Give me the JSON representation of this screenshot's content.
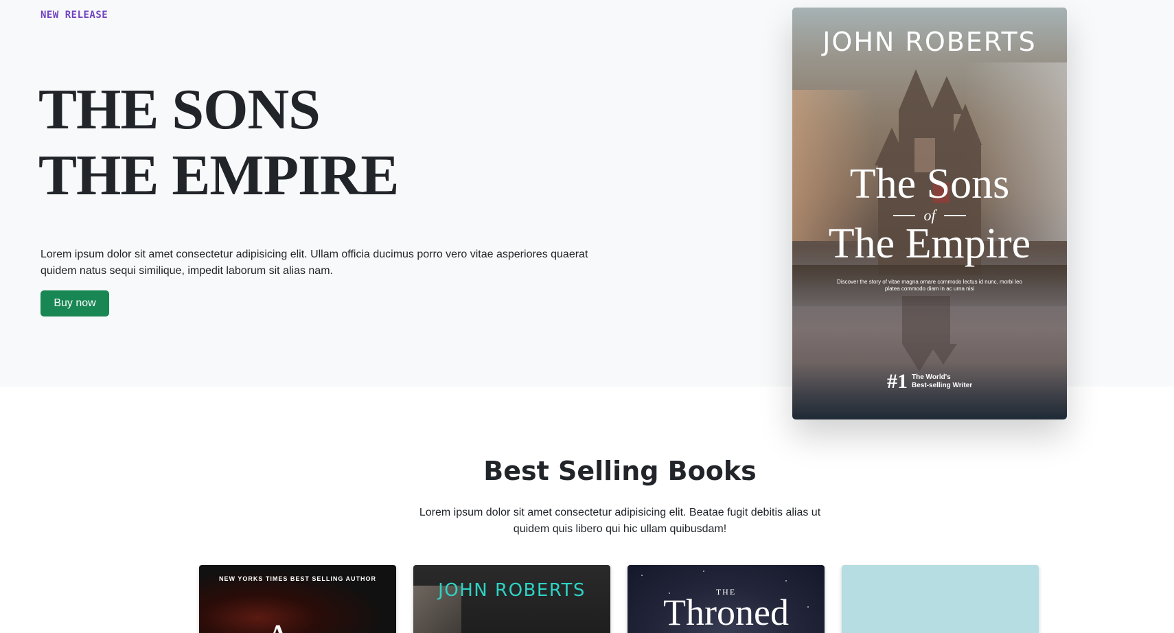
{
  "hero": {
    "eyebrow": "NEW RELEASE",
    "title_line1": "THE SONS",
    "title_line2": "THE EMPIRE",
    "description": "Lorem ipsum dolor sit amet consectetur adipisicing elit. Ullam officia ducimus porro vero vitae asperiores quaerat quidem natus sequi similique, impedit laborum sit alias nam.",
    "button_label": "Buy now",
    "button_color": "#198754",
    "eyebrow_color": "#6f42c1"
  },
  "cover": {
    "author": "JOHN ROBERTS",
    "title_line1": "The Sons",
    "title_of": "of",
    "title_line2": "The Empire",
    "blurb": "Discover the story of vitae magna ornare commodo lectus id nunc, morbi leo platea commodo diam in ac urna nisi",
    "badge_number": "#1",
    "badge_text_line1": "The World's",
    "badge_text_line2": "Best-selling Writer"
  },
  "best_selling": {
    "title": "Best Selling Books",
    "description": "Lorem ipsum dolor sit amet consectetur adipisicing elit. Beatae fugit debitis alias ut quidem quis libero qui hic ullam quibusdam!",
    "books": [
      {
        "top_label": "NEW YORKS TIMES BEST SELLING AUTHOR",
        "big_text": "A"
      },
      {
        "top_label": "JOHN ROBERTS",
        "accent_color": "#2ed3c4"
      },
      {
        "small_text": "THE",
        "big_text": "Throned"
      },
      {
        "background_color": "#b5dde2"
      }
    ]
  }
}
